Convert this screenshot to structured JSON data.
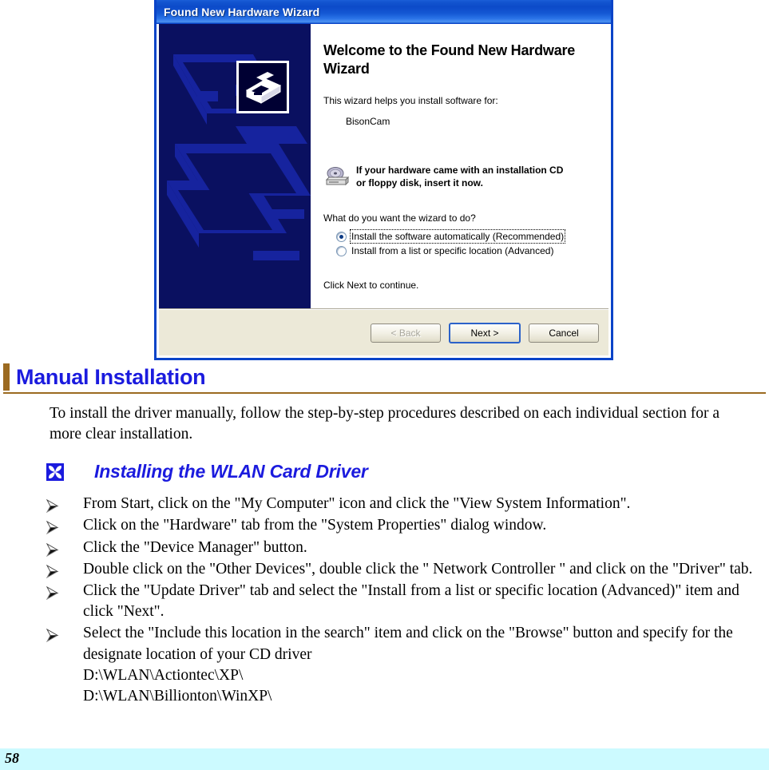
{
  "colors": {
    "heading_blue": "#1b1bde",
    "accent_brown": "#9b6a21",
    "footer_cyan": "#ccfaff",
    "xp_title_blue": "#0c4ac9",
    "xp_panel_navy": "#0a1060",
    "xp_face_beige": "#ece9d8"
  },
  "wizard": {
    "title": "Found New Hardware Wizard",
    "icons": {
      "hardware": "hardware-device-icon",
      "cd": "cd-drive-icon"
    },
    "welcome_heading": "Welcome to the Found New Hardware Wizard",
    "intro_text": "This wizard helps you install software for:",
    "device_name": "BisonCam",
    "cd_notice_line1": "If your hardware came with an installation CD",
    "cd_notice_line2": "or floppy disk, insert it now.",
    "question": "What do you want the wizard to do?",
    "options": [
      {
        "label_pre": "I",
        "label_accel": "n",
        "label_post": "stall the software automatically (Recommended)",
        "full_label": "Install the software automatically (Recommended)",
        "checked": true,
        "focused": true
      },
      {
        "label_pre": "Install from a list or ",
        "label_accel": "s",
        "label_post": "pecific location (Advanced)",
        "full_label": "Install from a list or specific location (Advanced)",
        "checked": false,
        "focused": false
      }
    ],
    "footer_hint": "Click Next to continue.",
    "buttons": [
      {
        "name": "back-button",
        "pre": "< ",
        "accel": "B",
        "post": "ack",
        "full_label": "< Back",
        "state": "disabled"
      },
      {
        "name": "next-button",
        "pre": "",
        "accel": "N",
        "post": "ext >",
        "full_label": "Next >",
        "state": "default"
      },
      {
        "name": "cancel-button",
        "pre": "Cancel",
        "accel": "",
        "post": "",
        "full_label": "Cancel",
        "state": "normal"
      }
    ]
  },
  "document": {
    "heading": "Manual Installation",
    "intro_paragraph": "To install the driver manually, follow the step-by-step procedures described on each individual section for a more clear installation.",
    "subheading": "Installing the WLAN Card Driver",
    "subheading_glyph": "wingdings-floral-square-icon",
    "bullet_glyph": "wingdings-arrowhead-bullet-icon",
    "steps": [
      "From Start, click on the \"My Computer\" icon and click the \"View System Information\".",
      "Click on the \"Hardware\" tab from the \"System Properties\" dialog window.",
      "Click the \"Device Manager\" button.",
      "Double click on the \"Other Devices\", double click the \" Network Controller \" and click on the \"Driver\" tab.",
      "Click the \"Update Driver\" tab and select the \"Install from a list or specific location (Advanced)\" item and click \"Next\".",
      "Select the \"Include this location in the search\" item and click on the \"Browse\" button and specify for the designate location of your CD driver\nD:\\WLAN\\Actiontec\\XP\\\nD:\\WLAN\\Billionton\\WinXP\\"
    ]
  },
  "footer": {
    "page_number": "58"
  }
}
